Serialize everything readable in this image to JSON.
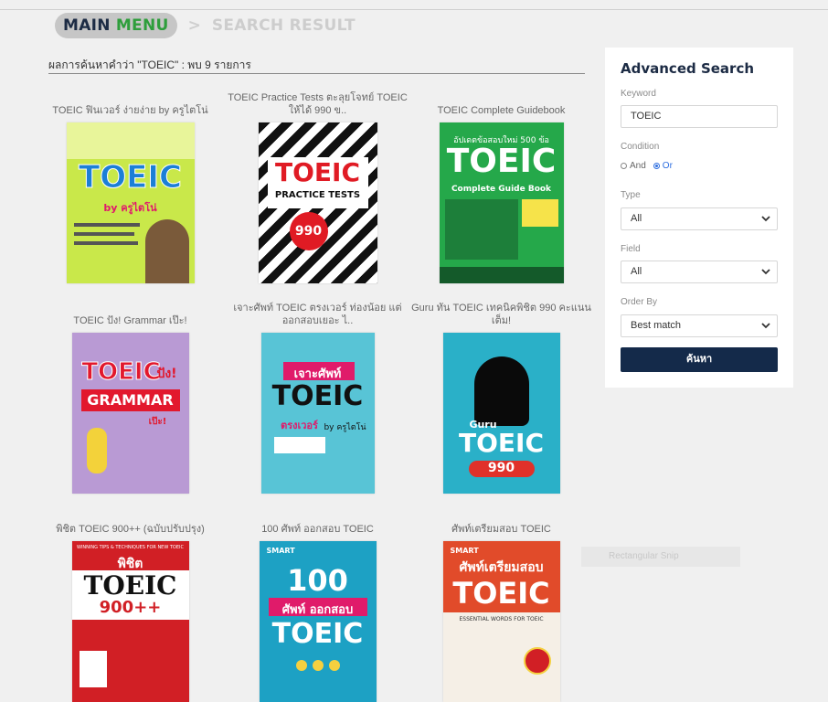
{
  "breadcrumb": {
    "main_word1": "MAIN",
    "main_word2": "MENU",
    "separator": ">",
    "current": "SEARCH RESULT"
  },
  "results": {
    "heading": "ผลการค้นหาคำว่า \"TOEIC\" : พบ 9 รายการ",
    "books": [
      {
        "title": "TOEIC ฟินเวอร์ ง่ายง่าย by ครูไตโน่",
        "cover_big": "TOEIC",
        "cover_sub": "by ครูไตโน่"
      },
      {
        "title": "TOEIC Practice Tests ตะลุยโจทย์ TOEIC ให้ได้ 990 ข..",
        "cover_big": "TOEIC",
        "cover_sub": "PRACTICE TESTS",
        "cover_extra": "990"
      },
      {
        "title": "TOEIC Complete Guidebook",
        "cover_top": "อัปเดตข้อสอบใหม่ 500 ข้อ",
        "cover_big": "TOEIC",
        "cover_sub": "Complete Guide Book"
      },
      {
        "title": "TOEIC ปัง! Grammar เป๊ะ!",
        "cover_big": "TOEIC",
        "cover_big2": "ปัง!",
        "cover_sub": "GRAMMAR",
        "cover_sub2": "เป๊ะ!"
      },
      {
        "title": "เจาะศัพท์ TOEIC ตรงเวอร์ ท่องน้อย แต่ออกสอบเยอะ ไ..",
        "cover_top": "เจาะศัพท์",
        "cover_big": "TOEIC",
        "cover_sub": "ตรงเวอร์",
        "cover_sub2": "by ครูไตโน่"
      },
      {
        "title": "Guru ทัน TOEIC เทคนิคพิชิต 990 คะแนนเต็ม!",
        "cover_top": "Guru",
        "cover_big": "TOEIC",
        "cover_sub": "990"
      },
      {
        "title": "พิชิต TOEIC 900++ (ฉบับปรับปรุง)",
        "cover_top": "WINNING TIPS & TECHNIQUES FOR NEW TOEIC",
        "cover_mid": "พิชิต",
        "cover_big": "TOEIC",
        "cover_sub": "900++"
      },
      {
        "title": "100 ศัพท์ ออกสอบ TOEIC",
        "cover_top": "SMART",
        "cover_mid": "100",
        "cover_sub": "ศัพท์ ออกสอบ",
        "cover_big": "TOEIC"
      },
      {
        "title": "ศัพท์เตรียมสอบ TOEIC",
        "cover_top": "SMART",
        "cover_mid": "ศัพท์เตรียมสอบ",
        "cover_big": "TOEIC",
        "cover_sub": "ESSENTIAL WORDS FOR TOEIC"
      }
    ]
  },
  "sidebar": {
    "title": "Advanced Search",
    "keyword_label": "Keyword",
    "keyword_value": "TOEIC",
    "condition_label": "Condition",
    "condition_options": [
      "And",
      "Or"
    ],
    "condition_selected": "Or",
    "type_label": "Type",
    "type_value": "All",
    "field_label": "Field",
    "field_value": "All",
    "order_label": "Order By",
    "order_value": "Best match",
    "search_button": "ค้นหา"
  },
  "ghost_text": "Rectangular Snip",
  "colors": {
    "navy": "#142a4a",
    "green": "#2e9e3c",
    "background": "#f0f0f0"
  }
}
